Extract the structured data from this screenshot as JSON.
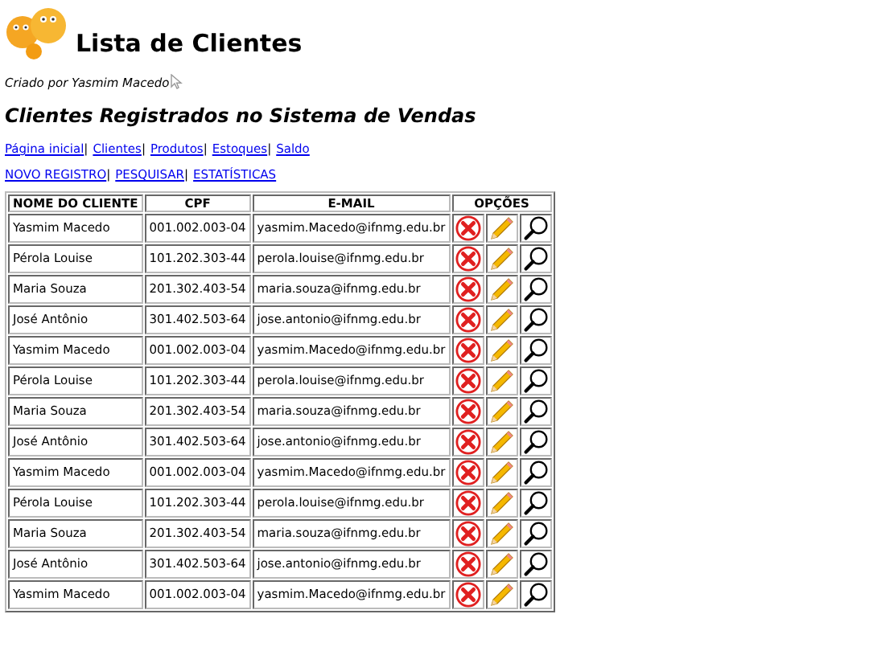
{
  "title": "Lista de Clientes",
  "credit": "Criado por Yasmim Macedo",
  "subtitle": "Clientes Registrados no Sistema de Vendas",
  "link_separator": "|",
  "nav_links": [
    "Página inicial",
    "Clientes",
    "Produtos",
    "Estoques",
    "Saldo"
  ],
  "action_links": [
    "NOVO REGISTRO",
    "PESQUISAR",
    "ESTATÍSTICAS"
  ],
  "table": {
    "columns": [
      "NOME DO CLIENTE",
      "CPF",
      "E-MAIL",
      "OPÇÕES"
    ],
    "rows": [
      {
        "name": "Yasmim Macedo",
        "cpf": "001.002.003-04",
        "email": "yasmim.Macedo@ifnmg.edu.br"
      },
      {
        "name": "Pérola Louise",
        "cpf": "101.202.303-44",
        "email": "perola.louise@ifnmg.edu.br"
      },
      {
        "name": "Maria Souza",
        "cpf": "201.302.403-54",
        "email": "maria.souza@ifnmg.edu.br"
      },
      {
        "name": "José Antônio",
        "cpf": "301.402.503-64",
        "email": "jose.antonio@ifnmg.edu.br"
      },
      {
        "name": "Yasmim Macedo",
        "cpf": "001.002.003-04",
        "email": "yasmim.Macedo@ifnmg.edu.br"
      },
      {
        "name": "Pérola Louise",
        "cpf": "101.202.303-44",
        "email": "perola.louise@ifnmg.edu.br"
      },
      {
        "name": "Maria Souza",
        "cpf": "201.302.403-54",
        "email": "maria.souza@ifnmg.edu.br"
      },
      {
        "name": "José Antônio",
        "cpf": "301.402.503-64",
        "email": "jose.antonio@ifnmg.edu.br"
      },
      {
        "name": "Yasmim Macedo",
        "cpf": "001.002.003-04",
        "email": "yasmim.Macedo@ifnmg.edu.br"
      },
      {
        "name": "Pérola Louise",
        "cpf": "101.202.303-44",
        "email": "perola.louise@ifnmg.edu.br"
      },
      {
        "name": "Maria Souza",
        "cpf": "201.302.403-54",
        "email": "maria.souza@ifnmg.edu.br"
      },
      {
        "name": "José Antônio",
        "cpf": "301.402.503-64",
        "email": "jose.antonio@ifnmg.edu.br"
      },
      {
        "name": "Yasmim Macedo",
        "cpf": "001.002.003-04",
        "email": "yasmim.Macedo@ifnmg.edu.br"
      }
    ]
  }
}
